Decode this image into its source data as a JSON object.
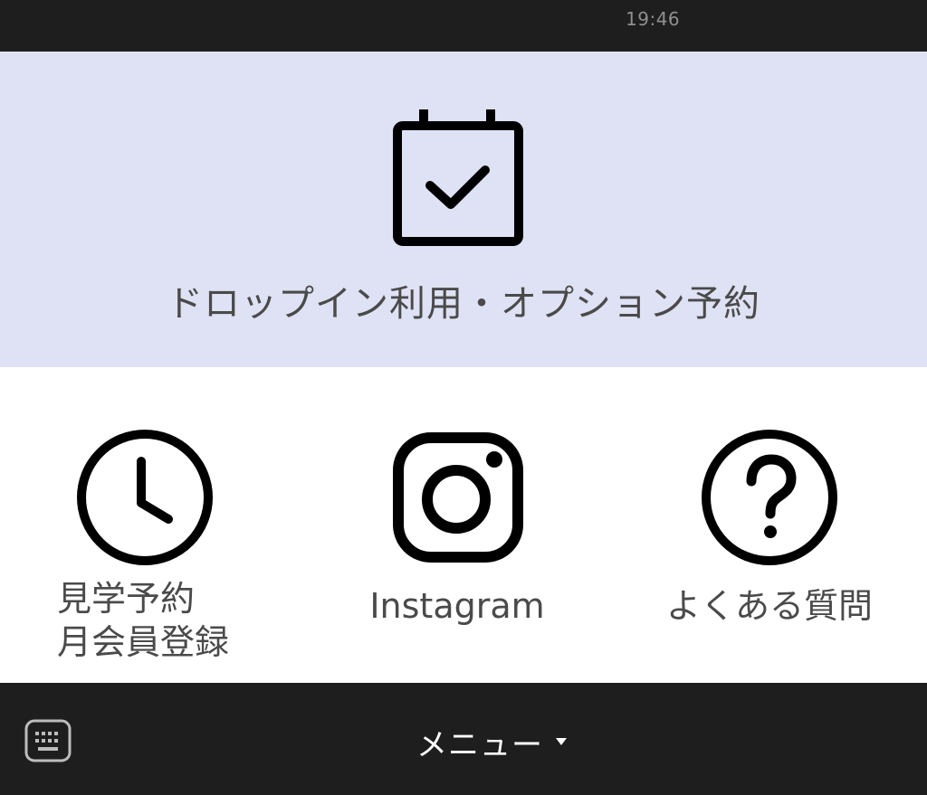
{
  "status_bar": {
    "time": "19:46"
  },
  "hero": {
    "icon": "calendar-check-icon",
    "label": "ドロップイン利用・オプション予約"
  },
  "tiles": [
    {
      "icon": "clock-icon",
      "label_lines": [
        "見学予約",
        "月会員登録"
      ]
    },
    {
      "icon": "instagram-icon",
      "label": "Instagram"
    },
    {
      "icon": "question-circle-icon",
      "label": "よくある質問"
    }
  ],
  "bottom_bar": {
    "keyboard_icon": "keyboard-icon",
    "menu_label": "メニュー",
    "menu_caret_icon": "caret-down-icon"
  },
  "colors": {
    "bars": "#1e1e1e",
    "hero_background": "#dfe2f4",
    "label_text": "#4a4a4a",
    "icon_stroke": "#000000"
  }
}
